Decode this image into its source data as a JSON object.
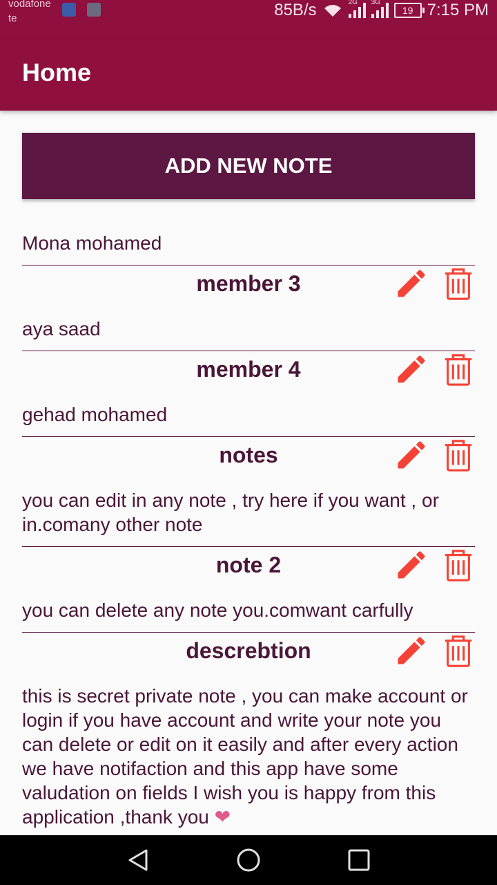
{
  "status_bar": {
    "carrier_line1": "vodafone",
    "carrier_line2": "te",
    "speed": "85B/s",
    "net1": "2G",
    "net2": "3G",
    "battery": "19",
    "time": "7:15 PM"
  },
  "app_bar": {
    "title": "Home"
  },
  "add_button": {
    "label": "ADD NEW NOTE"
  },
  "notes": {
    "first_body": "Mona mohamed",
    "items": [
      {
        "title": "member 3",
        "body": "aya saad"
      },
      {
        "title": "member 4",
        "body": "gehad mohamed"
      },
      {
        "title": "notes",
        "body": "you can edit in any note , try here if you want , or in.comany other note"
      },
      {
        "title": "note 2",
        "body": "you can delete any note you.comwant carfully"
      },
      {
        "title": "descrebtion",
        "body": "this is secret private note , you can make account or login if you have account and write your note you can delete or edit on it easily and after every action we have notifaction and this app have some valudation on fields I wish you is happy from this application ,thank you",
        "emoji": "❤"
      }
    ]
  },
  "colors": {
    "app_bar": "#8f0f3f",
    "button": "#5c1843",
    "text": "#4a1638",
    "icons": "#f44336"
  },
  "icons": {
    "edit": "pencil-icon",
    "delete": "trash-icon",
    "nav": [
      "back-icon",
      "home-icon",
      "recents-icon"
    ]
  }
}
